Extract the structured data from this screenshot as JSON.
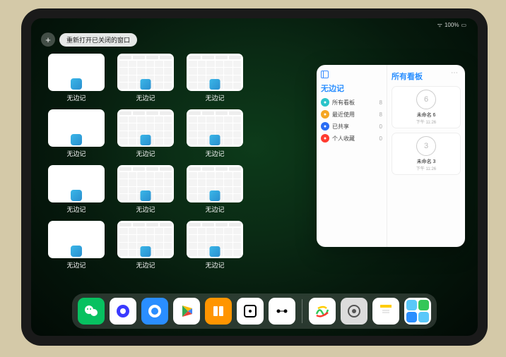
{
  "status": {
    "battery": "100%",
    "time": ""
  },
  "toolbar": {
    "plus": "+",
    "prompt": "重新打开已关闭的窗口"
  },
  "thumb_label": "无边记",
  "thumbnails": [
    {
      "type": "blank"
    },
    {
      "type": "cal"
    },
    {
      "type": "cal"
    },
    {
      "type": "blank"
    },
    {
      "type": "cal"
    },
    {
      "type": "cal"
    },
    {
      "type": "blank"
    },
    {
      "type": "cal"
    },
    {
      "type": "cal"
    },
    {
      "type": "blank"
    },
    {
      "type": "cal"
    },
    {
      "type": "cal"
    }
  ],
  "popup": {
    "left_title": "无边记",
    "right_title": "所有看板",
    "menu": [
      {
        "icon_color": "#2ac4c9",
        "label": "所有看板",
        "count": "8"
      },
      {
        "icon_color": "#f5a623",
        "label": "最近使用",
        "count": "8"
      },
      {
        "icon_color": "#2a6df4",
        "label": "已共享",
        "count": "0"
      },
      {
        "icon_color": "#ff3b30",
        "label": "个人收藏",
        "count": "0"
      }
    ],
    "boards": [
      {
        "draw": "6",
        "name": "未命名 6",
        "ts": "下午 11:26"
      },
      {
        "draw": "3",
        "name": "未命名 3",
        "ts": "下午 11:26"
      }
    ]
  },
  "dock": [
    {
      "name": "wechat",
      "bg": "#07c160"
    },
    {
      "name": "quark",
      "bg": "#ffffff"
    },
    {
      "name": "qqbrowser",
      "bg": "#2a8eff"
    },
    {
      "name": "play",
      "bg": "#ffffff"
    },
    {
      "name": "books",
      "bg": "#ff9500"
    },
    {
      "name": "dice",
      "bg": "#ffffff"
    },
    {
      "name": "dots",
      "bg": "#ffffff"
    },
    {
      "name": "freeform",
      "bg": "#ffffff"
    },
    {
      "name": "settings",
      "bg": "#dcdcdc"
    },
    {
      "name": "notes",
      "bg": "#ffffff"
    },
    {
      "name": "folder",
      "bg": "#ffffff"
    }
  ]
}
